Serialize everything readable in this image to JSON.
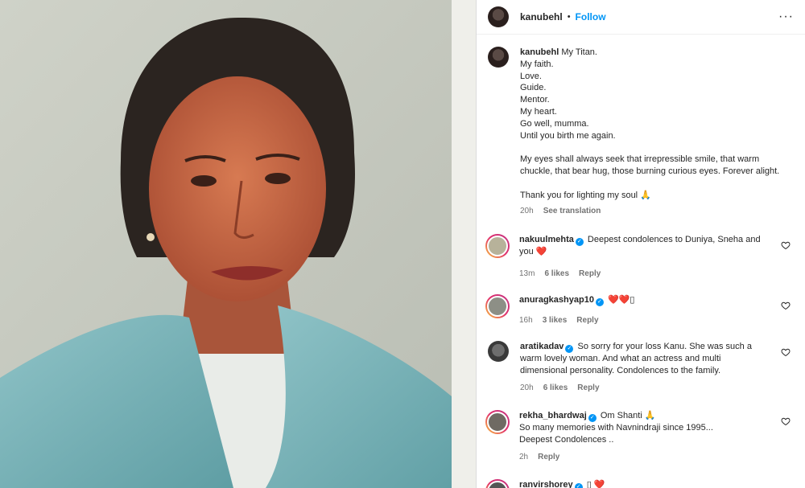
{
  "header": {
    "username": "kanubehl",
    "follow_label": "Follow",
    "more_icon": "more-icon"
  },
  "caption": {
    "username": "kanubehl",
    "text": "My Titan.\nMy faith.\nLove.\nGuide.\nMentor.\nMy heart.\nGo well, mumma.\nUntil you birth me again.\n\nMy eyes shall always seek that irrepressible smile, that warm chuckle, that bear hug, those burning curious eyes. Forever alight.\n\nThank you for lighting my soul 🙏",
    "time": "20h",
    "see_translation": "See translation"
  },
  "comments": [
    {
      "username": "nakuulmehta",
      "verified": true,
      "text": "Deepest condolences to Duniya, Sneha and you ❤️",
      "time": "13m",
      "likes": "6 likes",
      "reply": "Reply"
    },
    {
      "username": "anuragkashyap10",
      "verified": true,
      "text": "❤️❤️▯",
      "time": "16h",
      "likes": "3 likes",
      "reply": "Reply"
    },
    {
      "username": "aratikadav",
      "verified": true,
      "text": "So sorry for your loss Kanu. She was such a warm lovely woman. And what an actress and multi dimensional personality. Condolences to the family.",
      "time": "20h",
      "likes": "6 likes",
      "reply": "Reply"
    },
    {
      "username": "rekha_bhardwaj",
      "verified": true,
      "text": "Om Shanti 🙏\nSo many memories with Navnindraji since 1995...\nDeepest Condolences ..",
      "time": "2h",
      "likes": "",
      "reply": "Reply"
    },
    {
      "username": "ranvirshorey",
      "verified": true,
      "text": "▯ ❤️",
      "time": "",
      "likes": "",
      "reply": ""
    }
  ],
  "colors": {
    "accent": "#0095f6",
    "heart": "#e0245e"
  }
}
